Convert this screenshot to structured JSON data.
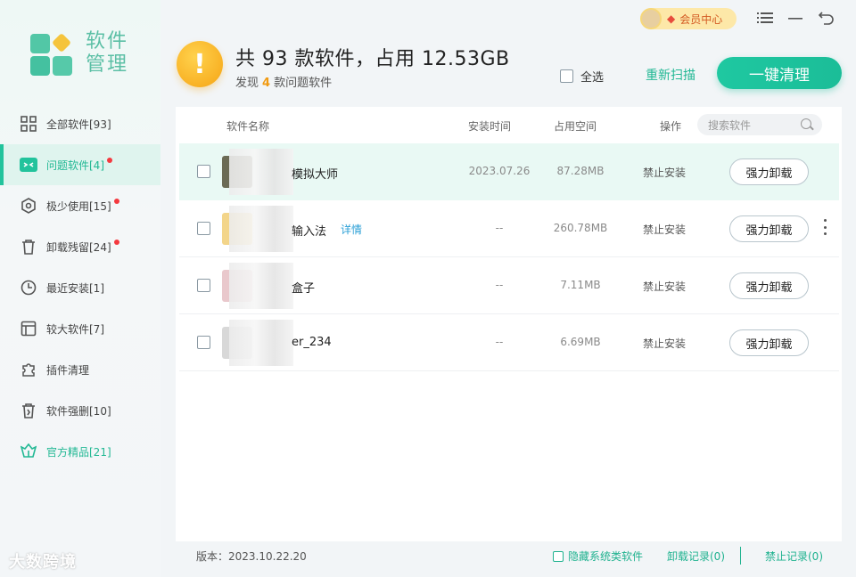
{
  "sidebar": {
    "logo_text": "软件\n管理",
    "items": [
      {
        "label": "全部软件[93]",
        "icon": "grid-icon",
        "active": false,
        "dot": false,
        "green": false
      },
      {
        "label": "问题软件[4]",
        "icon": "problem-icon",
        "active": true,
        "dot": true,
        "green": false
      },
      {
        "label": "极少使用[15]",
        "icon": "rarely-used-icon",
        "active": false,
        "dot": true,
        "green": false
      },
      {
        "label": "卸载残留[24]",
        "icon": "trash-icon",
        "active": false,
        "dot": true,
        "green": false
      },
      {
        "label": "最近安装[1]",
        "icon": "clock-icon",
        "active": false,
        "dot": false,
        "green": false
      },
      {
        "label": "较大软件[7]",
        "icon": "window-icon",
        "active": false,
        "dot": false,
        "green": false
      },
      {
        "label": "插件清理",
        "icon": "puzzle-icon",
        "active": false,
        "dot": false,
        "green": false
      },
      {
        "label": "软件强删[10]",
        "icon": "force-delete-icon",
        "active": false,
        "dot": false,
        "green": false
      },
      {
        "label": "官方精品[21]",
        "icon": "crown-icon",
        "active": false,
        "dot": false,
        "green": true
      }
    ],
    "watermark": "大数跨境"
  },
  "topbar": {
    "vip_label": "会员中心",
    "icons": [
      "menu-icon",
      "minimize-icon",
      "back-icon"
    ]
  },
  "header": {
    "summary": "共 93 款软件，占用 12.53GB",
    "sub_prefix": "发现",
    "problem_count": "4",
    "sub_suffix": "款问题软件",
    "select_all": "全选",
    "rescan": "重新扫描",
    "clean": "一键清理"
  },
  "table": {
    "columns": {
      "name": "软件名称",
      "install_time": "安装时间",
      "space": "占用空间",
      "action": "操作"
    },
    "search_placeholder": "搜索软件",
    "rows": [
      {
        "name": "模拟大师",
        "detail": "",
        "date": "2023.07.26",
        "size": "87.28MB",
        "op": "禁止安装",
        "button": "强力卸载",
        "icon_color": "#6b6b55"
      },
      {
        "name": "输入法",
        "detail": "详情",
        "date": "--",
        "size": "260.78MB",
        "op": "禁止安装",
        "button": "强力卸载",
        "icon_color": "#f3d58a"
      },
      {
        "name": "盒子",
        "detail": "",
        "date": "--",
        "size": "7.11MB",
        "op": "禁止安装",
        "button": "强力卸载",
        "icon_color": "#e9c8cc"
      },
      {
        "name": "er_234",
        "detail": "",
        "date": "--",
        "size": "6.69MB",
        "op": "禁止安装",
        "button": "强力卸载",
        "icon_color": "#d8d8d8"
      }
    ]
  },
  "footer": {
    "version": "版本：2023.10.22.20",
    "hide_system": "隐藏系统类软件",
    "uninstall_log": "卸载记录(0)",
    "ban_log": "禁止记录(0)"
  },
  "colors": {
    "accent": "#1fc8a1",
    "warning": "#f6a414",
    "link": "#2a9fd6",
    "dot": "#f4393f"
  }
}
